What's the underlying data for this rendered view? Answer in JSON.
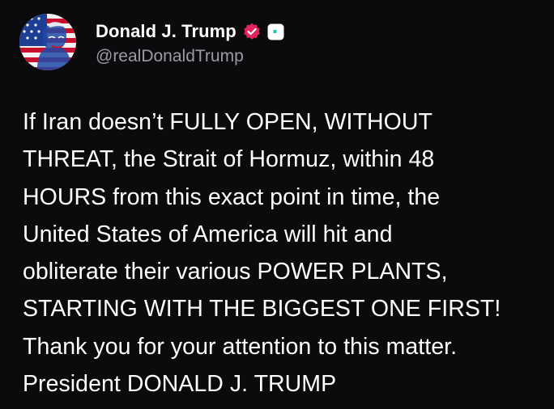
{
  "author": {
    "display_name": "Donald J. Trump",
    "handle": "@realDonaldTrump",
    "verified_icon": "verified-check-icon",
    "badge_icon": "affiliate-badge-icon"
  },
  "post": {
    "lines": [
      "If Iran doesn’t FULLY OPEN, WITHOUT",
      "THREAT, the Strait of Hormuz, within 48",
      "HOURS from this exact point in time, the",
      "United States of America will hit and",
      "obliterate their various POWER PLANTS,",
      "STARTING WITH THE BIGGEST ONE FIRST!",
      "Thank you for your attention to this matter.",
      "President DONALD J. TRUMP"
    ]
  },
  "colors": {
    "background": "#0b0b0d",
    "text": "#ffffff",
    "handle": "#9b9ba3",
    "verified": "#e0245e"
  }
}
